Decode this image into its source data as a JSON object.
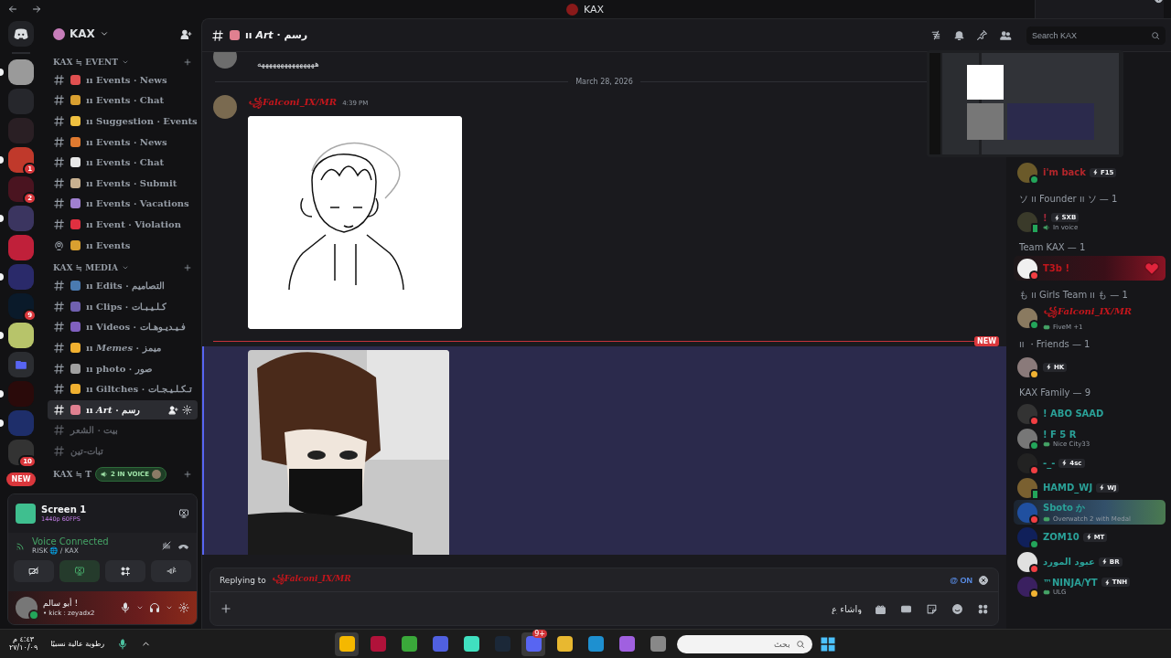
{
  "titlebar": {
    "title": "KAX"
  },
  "servers": [
    {
      "kind": "server",
      "unread": true
    },
    {
      "kind": "server",
      "unread": false
    },
    {
      "kind": "server",
      "unread": false
    },
    {
      "kind": "server",
      "unread": true,
      "badge": "1"
    },
    {
      "kind": "server",
      "unread": false,
      "badge": "2"
    },
    {
      "kind": "server",
      "unread": true
    },
    {
      "kind": "server",
      "unread": false
    },
    {
      "kind": "server",
      "unread": true
    },
    {
      "kind": "server",
      "unread": false,
      "badge": "9"
    },
    {
      "kind": "server",
      "unread": true
    },
    {
      "kind": "folder",
      "unread": false
    },
    {
      "kind": "server",
      "unread": true
    },
    {
      "kind": "server",
      "unread": true
    },
    {
      "kind": "server",
      "unread": false,
      "badge": "10"
    }
  ],
  "rail_new": "NEW",
  "sidebar": {
    "server_name": "KAX",
    "categories": [
      {
        "title": "KAX ≒ EVENT",
        "channels": [
          {
            "kind": "text",
            "name": "ıı Events · News",
            "selected": false,
            "muted": false
          },
          {
            "kind": "text",
            "name": "ıı Events · Chat",
            "selected": false,
            "muted": false
          },
          {
            "kind": "text",
            "name": "ıı Suggestion · Events",
            "selected": false,
            "muted": false
          },
          {
            "kind": "text",
            "name": "ıı Events · News",
            "selected": false,
            "muted": false
          },
          {
            "kind": "text",
            "name": "ıı Events · Chat",
            "selected": false,
            "muted": false
          },
          {
            "kind": "text",
            "name": "ıı Events · Submit",
            "selected": false,
            "muted": false
          },
          {
            "kind": "text",
            "name": "ıı Events · Vacations",
            "selected": false,
            "muted": false
          },
          {
            "kind": "text",
            "name": "ıı Event · Violation",
            "selected": false,
            "muted": false
          },
          {
            "kind": "stage",
            "name": "ıı Events",
            "selected": false,
            "muted": false
          }
        ]
      },
      {
        "title": "KAX ≒ MEDIA",
        "channels": [
          {
            "kind": "text",
            "name": "ıı Edits · التصاميم",
            "selected": false,
            "muted": false
          },
          {
            "kind": "text",
            "name": "ıı Clips · كـلـيـبـات",
            "selected": false,
            "muted": false
          },
          {
            "kind": "text",
            "name": "ıı Videos · فـيـديـوهـات",
            "selected": false,
            "muted": false
          },
          {
            "kind": "text",
            "name": "ıı *Memes* · ميمز",
            "selected": false,
            "muted": false
          },
          {
            "kind": "text",
            "name": "ıı photo · صور",
            "selected": false,
            "muted": false
          },
          {
            "kind": "text",
            "name": "ıı Giltches · تـكـلـيـجـات",
            "selected": false,
            "muted": false
          },
          {
            "kind": "text",
            "name": "ıı *Art* · رسم",
            "selected": true,
            "muted": false
          },
          {
            "kind": "text",
            "name": "بيت · الشعر",
            "selected": false,
            "muted": true
          },
          {
            "kind": "text",
            "name": "تبات-تين",
            "selected": false,
            "muted": true
          }
        ]
      },
      {
        "title": "KAX ≒ T",
        "voice_pill": "2 IN VOICE"
      }
    ]
  },
  "stream": {
    "title": "Screen 1",
    "quality": "1440p 60FPS"
  },
  "voice": {
    "status": "Voice Connected",
    "location": "RISK 🌐 / KAX"
  },
  "user": {
    "name": "أبو سالم !",
    "status_text": "• kick : zeyadx2"
  },
  "channel_header": {
    "name": "ıı *Art* · رسم",
    "search_placeholder": "Search KAX"
  },
  "messages": [
    {
      "kind": "continuation",
      "text": "هههههههههههههههه"
    },
    {
      "kind": "date",
      "text": "March 28, 2026"
    },
    {
      "kind": "message",
      "author": "꧁Falconi_IX/MR",
      "color": "#c4161c",
      "time": "4:39 PM"
    },
    {
      "kind": "new",
      "text": "NEW"
    },
    {
      "kind": "attachment",
      "highlighted": true
    }
  ],
  "composer": {
    "reply_label": "Replying to",
    "reply_author": "꧁Falconi_IX/MR",
    "mention": "@ ON",
    "value": "واشاء ع"
  },
  "members": [
    {
      "members": [
        {
          "name": "i'm back",
          "color": "#b3262b",
          "status": {
            "kind": "online"
          },
          "tag": "F15"
        }
      ]
    },
    {
      "title": "ソ ıı Founder ıı ソ — 1",
      "members": [
        {
          "name": "!",
          "color": "#a0283a",
          "status": {
            "kind": "mobile"
          },
          "tag": "SXB",
          "sub": {
            "kind": "voice",
            "text": "In voice"
          }
        }
      ]
    },
    {
      "title": "Team KAX — 1",
      "members": [
        {
          "name": "T3b !",
          "color": "#c4161c",
          "status": {
            "kind": "dnd"
          },
          "banner": {
            "kind": "heart"
          }
        }
      ]
    },
    {
      "title": "も ıı Girls Team ıı も — 1",
      "members": [
        {
          "name": "꧁Falconi_IX/MR",
          "color": "#c4161c",
          "status": {
            "kind": "online"
          },
          "sub": {
            "kind": "game",
            "text": "FiveM +1"
          }
        }
      ]
    },
    {
      "title": "ıı ・Friends — 1",
      "members": [
        {
          "status": {
            "kind": "idle"
          },
          "tag": "HK"
        }
      ]
    },
    {
      "title": "KAX Family — 9",
      "members": [
        {
          "name": "! ABO SAAD",
          "color": "#2aa198",
          "status": {
            "kind": "dnd"
          }
        },
        {
          "name": "! F 5 R",
          "color": "#2aa198",
          "status": {
            "kind": "online"
          },
          "sub": {
            "kind": "game",
            "text": "Nice City33"
          }
        },
        {
          "name": "-_-",
          "color": "#2aa198",
          "status": {
            "kind": "dnd"
          },
          "tag": "4sc"
        },
        {
          "name": "HAMD_WJ",
          "color": "#2aa198",
          "status": {
            "kind": "mobile"
          },
          "tag": "WJ"
        },
        {
          "name": "Sboto か",
          "color": "#2aa198",
          "status": {
            "kind": "dnd"
          },
          "banner": {
            "kind": "scenery"
          },
          "sub": {
            "kind": "game",
            "text": "Overwatch 2 with Medal"
          }
        },
        {
          "name": "ZOM10",
          "color": "#2aa198",
          "status": {
            "kind": "online"
          },
          "tag": "MT"
        },
        {
          "name": "عبود المورد",
          "color": "#2aa198",
          "status": {
            "kind": "dnd"
          },
          "tag": "BR"
        },
        {
          "name": "™NINJA/YT",
          "color": "#2aa198",
          "status": {
            "kind": "idle"
          },
          "tag": "TNH",
          "sub": {
            "kind": "game",
            "text": "ULG"
          }
        }
      ]
    }
  ],
  "taskbar": {
    "time": "٤:٤٣ م",
    "date": "٢٧/١٠/٠٩",
    "weather": "رطوبة عالية نسبيًا",
    "search_placeholder": "بحث",
    "discord_badge": "9+"
  }
}
